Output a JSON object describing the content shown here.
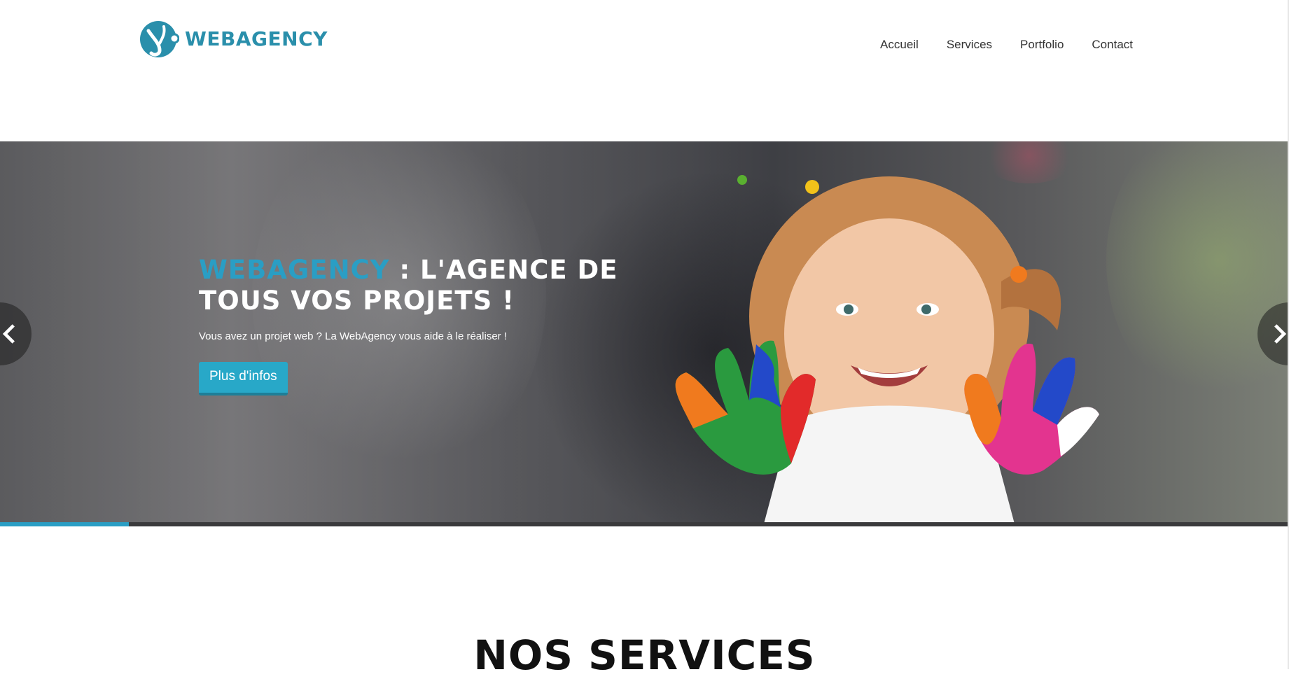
{
  "header": {
    "logo": {
      "text": "WEBAGENCY",
      "icon": "webagency-logo-icon"
    },
    "nav": [
      {
        "label": "Accueil"
      },
      {
        "label": "Services"
      },
      {
        "label": "Portfolio"
      },
      {
        "label": "Contact"
      }
    ]
  },
  "hero": {
    "title_brand": "WEBAGENCY",
    "title_rest": " : L'AGENCE DE TOUS VOS PROJETS !",
    "subtitle": "Vous avez un projet web ? La WebAgency vous aide à le réaliser !",
    "button_label": "Plus d'infos",
    "prev_icon": "chevron-left-icon",
    "next_icon": "chevron-right-icon",
    "progress_fraction": 0.1
  },
  "services": {
    "title": "NOS SERVICES"
  },
  "colors": {
    "accent": "#2a9ec4",
    "button": "#28a8c8",
    "logo": "#2a8fab"
  }
}
